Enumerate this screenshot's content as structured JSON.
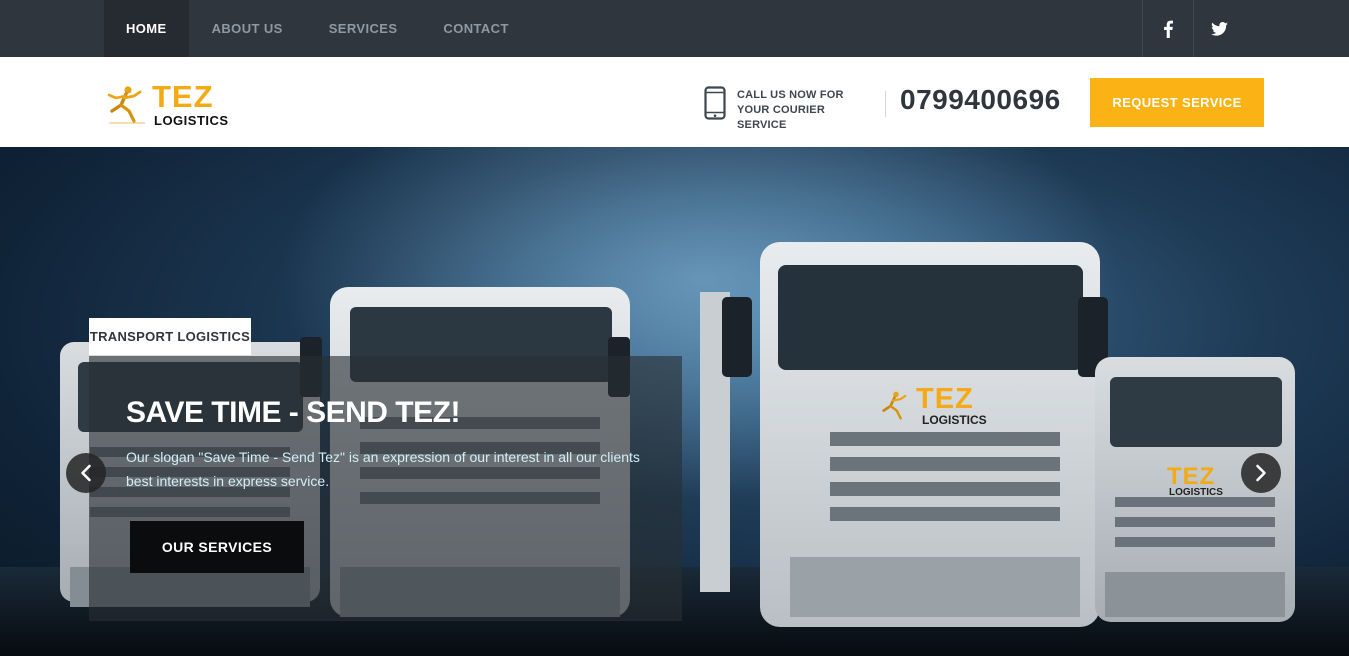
{
  "nav": {
    "items": [
      {
        "label": "HOME",
        "active": true
      },
      {
        "label": "ABOUT US",
        "active": false
      },
      {
        "label": "SERVICES",
        "active": false
      },
      {
        "label": "CONTACT",
        "active": false
      }
    ],
    "social_icons": [
      "facebook-icon",
      "twitter-icon"
    ]
  },
  "header": {
    "logo": {
      "brand": "TEZ",
      "sub": "LOGISTICS"
    },
    "call": {
      "line1": "CALL US NOW FOR",
      "line2": "YOUR COURIER SERVICE"
    },
    "phone": "0799400696",
    "request_label": "REQUEST SERVICE"
  },
  "hero": {
    "tag": "TRANSPORT LOGISTICS",
    "headline": "SAVE TIME - SEND TEZ!",
    "description": "Our slogan \"Save Time - Send Tez\" is an expression of our interest in all our clients best interests in express service.",
    "button_label": "OUR SERVICES",
    "truck_branding": {
      "brand": "TEZ",
      "sub": "LOGISTICS"
    }
  },
  "colors": {
    "accent": "#fbb214",
    "topbar": "#2f363d",
    "topbar_active": "#252b31",
    "dark_button": "#0b0c0d"
  }
}
